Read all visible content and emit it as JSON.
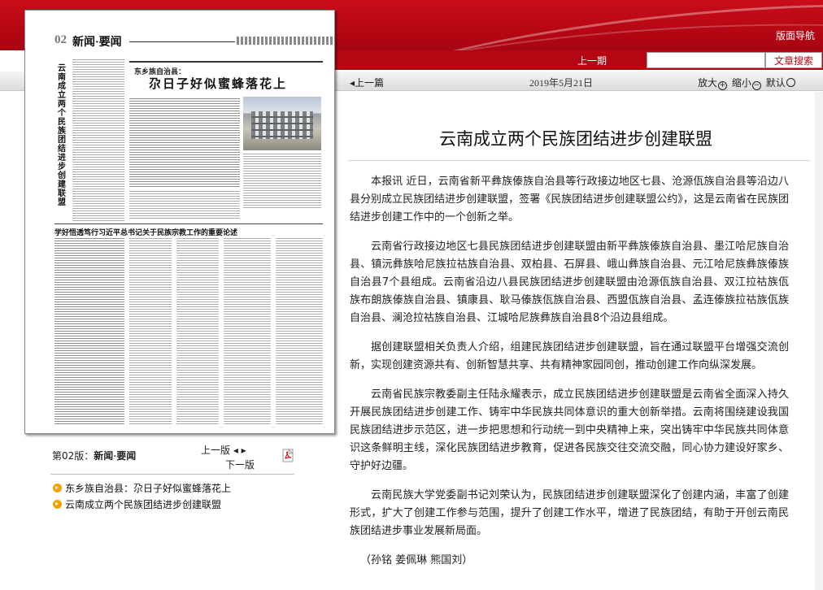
{
  "header": {
    "nav_link": "版面导航",
    "prev_issue": "上一期",
    "search_placeholder": "",
    "search_button": "文章搜索"
  },
  "toolbar": {
    "prev_article": "上一篇",
    "date": "2019年5月21日",
    "zoom_in": "放大",
    "zoom_out": "缩小",
    "zoom_default": "默认"
  },
  "paper": {
    "page_num": "02",
    "section": "新闻·要闻",
    "vertical_headline": "云南成立两个民族团结进步创建联盟",
    "box_subtitle": "东乡族自治县：",
    "box_headline": "尕日子好似蜜蜂落花上",
    "second_headline": "学好悟透笃行习近平总书记关于民族宗教工作的重要论述"
  },
  "page_nav": {
    "page_label_prefix": "第02版：",
    "page_label_name": "新闻·要闻",
    "prev_page": "上一版",
    "next_page": "下一版"
  },
  "story_list": [
    "东乡族自治县：尕日子好似蜜蜂落花上",
    "云南成立两个民族团结进步创建联盟"
  ],
  "article": {
    "title": "云南成立两个民族团结进步创建联盟",
    "paragraphs": [
      "本报讯 近日，云南省新平彝族傣族自治县等行政接边地区七县、沧源佤族自治县等沿边八县分别成立民族团结进步创建联盟，签署《民族团结进步创建联盟公约》，这是云南省在民族团结进步创建工作中的一个创新之举。",
      "云南省行政接边地区七县民族团结进步创建联盟由新平彝族傣族自治县、墨江哈尼族自治县、镇沅彝族哈尼族拉祜族自治县、双柏县、石屏县、峨山彝族自治县、元江哈尼族彝族傣族自治县7个县组成。云南省沿边八县民族团结进步创建联盟由沧源佤族自治县、双江拉祜族佤族布朗族傣族自治县、镇康县、耿马傣族佤族自治县、西盟佤族自治县、孟连傣族拉祜族佤族自治县、澜沧拉祜族自治县、江城哈尼族彝族自治县8个沿边县组成。",
      "据创建联盟相关负责人介绍，组建民族团结进步创建联盟，旨在通过联盟平台增强交流创新，实现创建资源共有、创新智慧共享、共有精神家园同创，推动创建工作向纵深发展。",
      "云南省民族宗教委副主任陆永耀表示，成立民族团结进步创建联盟是云南省全面深入持久开展民族团结进步创建工作、铸牢中华民族共同体意识的重大创新举措。云南将围绕建设我国民族团结进步示范区，进一步把思想和行动统一到中央精神上来，突出铸牢中华民族共同体意识这条鲜明主线，深化民族团结进步教育，促进各民族交往交流交融，同心协力建设好家乡、守护好边疆。",
      "云南民族大学党委副书记刘荣认为，民族团结进步创建联盟深化了创建内涵，丰富了创建形式，扩大了创建工作参与范围，提升了创建工作水平，增进了民族团结，有助于开创云南民族团结进步事业发展新局面。"
    ],
    "byline": "（孙铭 姜佩琳 熊国刘）"
  }
}
